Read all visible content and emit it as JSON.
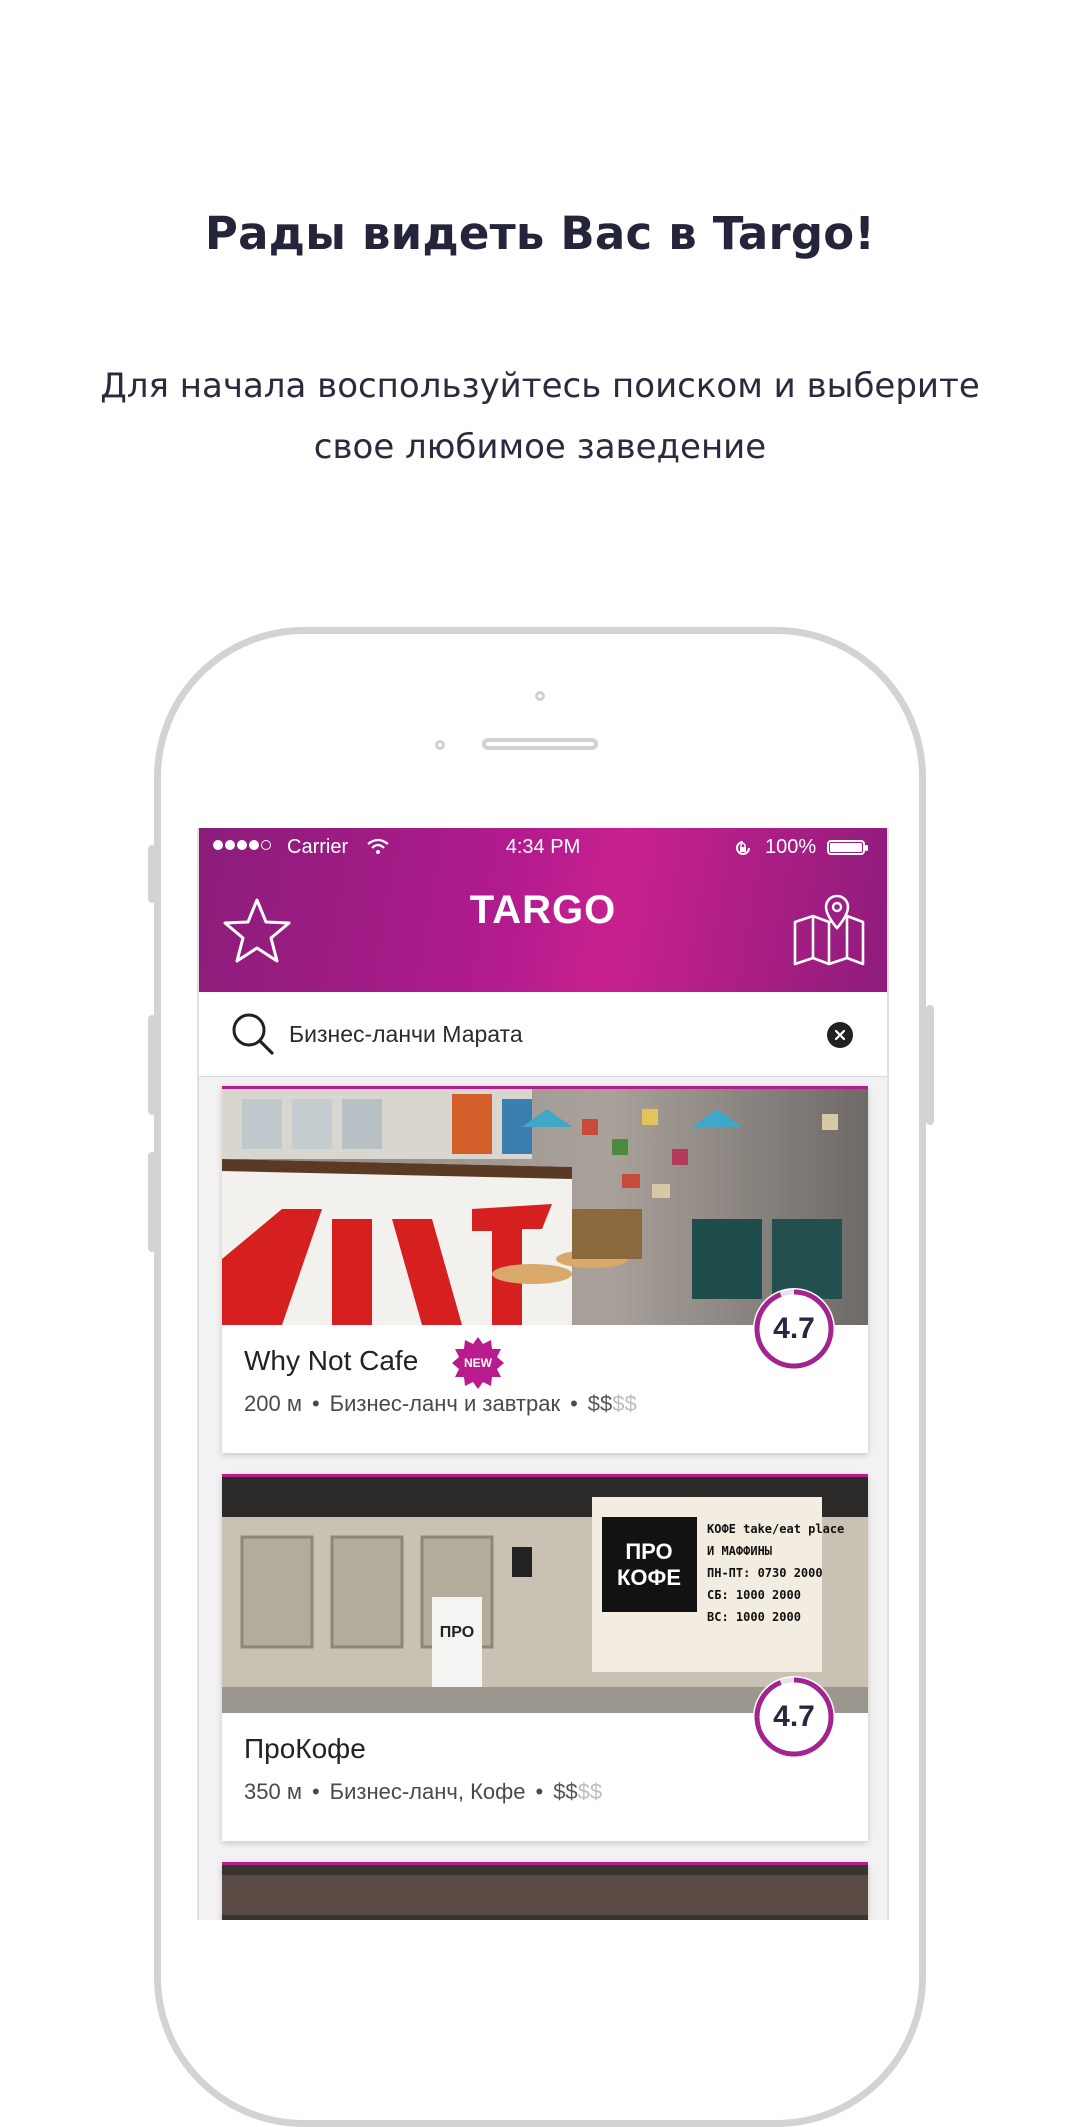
{
  "welcome": {
    "title": "Рады видеть Вас в Targo!",
    "subtitle_line1": "Для начала воспользуйтесь поиском и выберите",
    "subtitle_line2": "свое любимое заведение"
  },
  "status_bar": {
    "carrier": "Carrier",
    "time": "4:34 PM",
    "battery": "100%"
  },
  "app_bar": {
    "logo": "TARGO",
    "left_icon": "star-icon",
    "right_icon": "map-pin-icon"
  },
  "search": {
    "value": "Бизнес-ланчи Марата",
    "icon": "search-icon",
    "clear_icon": "clear-icon"
  },
  "cards": [
    {
      "title": "Why Not Cafe",
      "badge": "NEW",
      "distance": "200 м",
      "category": "Бизнес-ланч и завтрак",
      "price_on": "$$",
      "price_off": "$$",
      "rating": "4.7",
      "rating_fraction": 0.94
    },
    {
      "title": "ПроКофе",
      "distance": "350 м",
      "category": "Бизнес-ланч, Кофе",
      "price_on": "$$",
      "price_off": "$$",
      "rating": "4.7",
      "rating_fraction": 0.94
    }
  ],
  "colors": {
    "accent": "#b81b8d",
    "accent_dark": "#8a1d7a",
    "rating_ring": "#a3238f",
    "text_dark": "#24243a"
  }
}
